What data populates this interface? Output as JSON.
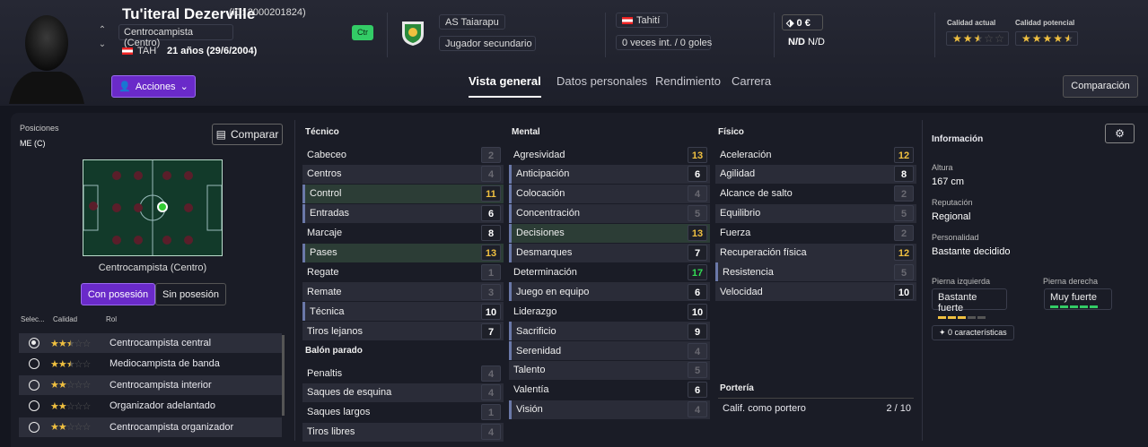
{
  "header": {
    "player_name": "Tu'iteral Dezerville",
    "player_id": "(ID: 2000201824)",
    "position": "Centrocampista (Centro)",
    "nationality_code": "TAH",
    "age": "21 años (29/6/2004)",
    "position_badge": "Ctr",
    "club": "AS Taiarapu",
    "squad_status": "Jugador secundario",
    "country": "Tahití",
    "caps": "0 veces int. / 0 goles",
    "value": "0 €",
    "wage_1": "N/D",
    "wage_2": "N/D",
    "current_quality_label": "Calidad actual",
    "potential_quality_label": "Calidad potencial",
    "current_stars": 2.5,
    "potential_stars": 4.5,
    "actions_label": "Acciones",
    "compare_button": "Comparación"
  },
  "tabs": [
    {
      "label": "Vista general",
      "active": true
    },
    {
      "label": "Datos personales"
    },
    {
      "label": "Rendimiento"
    },
    {
      "label": "Carrera"
    }
  ],
  "left": {
    "positions_label": "Posiciones",
    "positions_value": "ME (C)",
    "compare_label": "Comparar",
    "role_name": "Centrocampista (Centro)",
    "with_ball": "Con posesión",
    "without_ball": "Sin posesión",
    "col_select": "Selec...",
    "col_quality": "Calidad",
    "col_role": "Rol",
    "roles": [
      {
        "stars": 2.5,
        "name": "Centrocampista central",
        "selected": true
      },
      {
        "stars": 2.5,
        "name": "Mediocampista de banda"
      },
      {
        "stars": 2,
        "name": "Centrocampista interior"
      },
      {
        "stars": 2,
        "name": "Organizador adelantado"
      },
      {
        "stars": 2,
        "name": "Centrocampista organizador"
      }
    ]
  },
  "tecnico": {
    "title": "Técnico",
    "attrs": [
      {
        "n": "Cabeceo",
        "v": 2
      },
      {
        "n": "Centros",
        "v": 4
      },
      {
        "n": "Control",
        "v": 11,
        "hl": true
      },
      {
        "n": "Entradas",
        "v": 6,
        "hl": true
      },
      {
        "n": "Marcaje",
        "v": 8
      },
      {
        "n": "Pases",
        "v": 13,
        "hl": true
      },
      {
        "n": "Regate",
        "v": 1
      },
      {
        "n": "Remate",
        "v": 3
      },
      {
        "n": "Técnica",
        "v": 10,
        "hl": true
      },
      {
        "n": "Tiros lejanos",
        "v": 7
      }
    ]
  },
  "balon_parado": {
    "title": "Balón parado",
    "attrs": [
      {
        "n": "Penaltis",
        "v": 4
      },
      {
        "n": "Saques de esquina",
        "v": 4
      },
      {
        "n": "Saques largos",
        "v": 1
      },
      {
        "n": "Tiros libres",
        "v": 4
      }
    ]
  },
  "mental": {
    "title": "Mental",
    "attrs": [
      {
        "n": "Agresividad",
        "v": 13
      },
      {
        "n": "Anticipación",
        "v": 6,
        "hl": true
      },
      {
        "n": "Colocación",
        "v": 4,
        "hl": true
      },
      {
        "n": "Concentración",
        "v": 5,
        "hl": true
      },
      {
        "n": "Decisiones",
        "v": 13,
        "hl": true
      },
      {
        "n": "Desmarques",
        "v": 7,
        "hl": true
      },
      {
        "n": "Determinación",
        "v": 17
      },
      {
        "n": "Juego en equipo",
        "v": 6,
        "hl": true
      },
      {
        "n": "Liderazgo",
        "v": 10
      },
      {
        "n": "Sacrificio",
        "v": 9,
        "hl": true
      },
      {
        "n": "Serenidad",
        "v": 4,
        "hl": true
      },
      {
        "n": "Talento",
        "v": 5
      },
      {
        "n": "Valentía",
        "v": 6
      },
      {
        "n": "Visión",
        "v": 4,
        "hl": true
      }
    ]
  },
  "fisico": {
    "title": "Físico",
    "attrs": [
      {
        "n": "Aceleración",
        "v": 12
      },
      {
        "n": "Agilidad",
        "v": 8
      },
      {
        "n": "Alcance de salto",
        "v": 2
      },
      {
        "n": "Equilibrio",
        "v": 5
      },
      {
        "n": "Fuerza",
        "v": 2
      },
      {
        "n": "Recuperación física",
        "v": 12
      },
      {
        "n": "Resistencia",
        "v": 5,
        "hl": true
      },
      {
        "n": "Velocidad",
        "v": 10
      }
    ]
  },
  "porteria": {
    "title": "Portería",
    "label": "Calif. como portero",
    "value": "2 / 10"
  },
  "info": {
    "title": "Información",
    "height_label": "Altura",
    "height": "167 cm",
    "rep_label": "Reputación",
    "rep": "Regional",
    "pers_label": "Personalidad",
    "pers": "Bastante decidido",
    "left_foot_label": "Pierna izquierda",
    "left_foot": "Bastante fuerte",
    "left_foot_level": 3,
    "right_foot_label": "Pierna derecha",
    "right_foot": "Muy fuerte",
    "right_foot_level": 5,
    "traits": "0 características"
  },
  "colors": {
    "accent": "#6a2ac9",
    "gold": "#f0c040",
    "green": "#33cc66"
  }
}
